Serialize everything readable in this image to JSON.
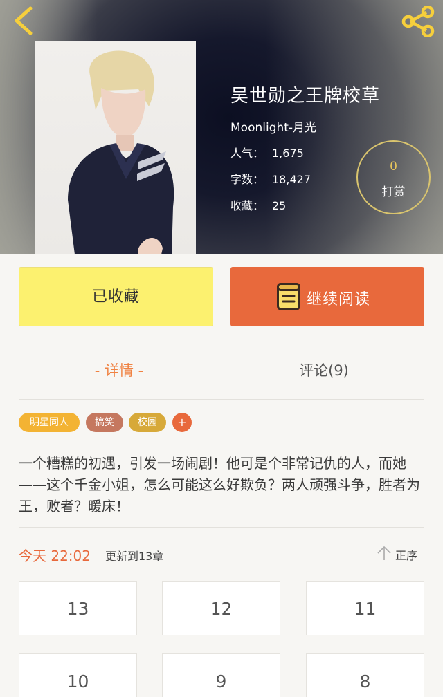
{
  "header": {
    "title": "吴世勋之王牌校草",
    "author": "Moonlight-月光",
    "stats": [
      {
        "label": "人气：",
        "value": "1,675"
      },
      {
        "label": "字数：",
        "value": "18,427"
      },
      {
        "label": "收藏：",
        "value": "25"
      }
    ],
    "tip": {
      "count": "0",
      "label": "打赏"
    }
  },
  "actions": {
    "favorite_label": "已收藏",
    "read_label": "继续阅读"
  },
  "tabs": {
    "detail": "- 详情 -",
    "comments": "评论(9)"
  },
  "tags": [
    "明星同人",
    "搞笑",
    "校园",
    "+"
  ],
  "summary": "一个糟糕的初遇，引发一场闹剧！他可是个非常记仇的人，而她——这个千金小姐，怎么可能这么好欺负？两人顽强斗争，胜者为王，败者？暖床！",
  "update": {
    "time": "今天 22:02",
    "text": "更新到13章",
    "sort_label": "正序"
  },
  "chapters": [
    "13",
    "12",
    "11",
    "10",
    "9",
    "8"
  ],
  "colors": {
    "accent": "#e8693c",
    "favorite_bg": "#fcf16f",
    "tag_star": "#f3b333",
    "tag_funny": "#c5785f",
    "tag_school": "#d7a939"
  }
}
